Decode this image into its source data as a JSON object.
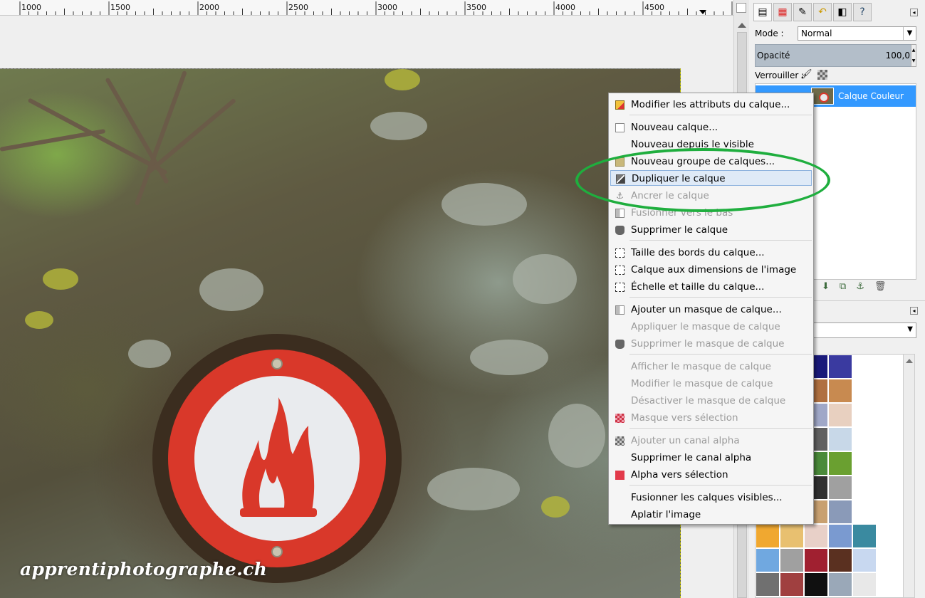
{
  "ruler": {
    "ticks": [
      "1000",
      "1500",
      "2000",
      "2500",
      "3000",
      "3500",
      "4000",
      "4500"
    ]
  },
  "canvas": {
    "watermark": "apprentiphotographe.ch"
  },
  "layers_panel": {
    "mode_label": "Mode :",
    "mode_value": "Normal",
    "opacity_label": "Opacité",
    "opacity_value": "100,0",
    "lock_label": "Verrouiller :",
    "layer_name": "Calque Couleur"
  },
  "context_menu": {
    "items": [
      {
        "label": "Modifier les attributs du calque...",
        "enabled": true,
        "icon": "pencil-icon"
      },
      {
        "label": "Nouveau calque...",
        "enabled": true,
        "icon": "new-document-icon"
      },
      {
        "label": "Nouveau depuis le visible",
        "enabled": true,
        "icon": ""
      },
      {
        "label": "Nouveau groupe de calques...",
        "enabled": true,
        "icon": "folder-icon"
      },
      {
        "label": "Dupliquer le calque",
        "enabled": true,
        "highlighted": true,
        "icon": "duplicate-icon"
      },
      {
        "label": "Ancrer le calque",
        "enabled": false,
        "icon": "anchor-icon"
      },
      {
        "label": "Fusionner vers le bas",
        "enabled": false,
        "icon": "merge-down-icon"
      },
      {
        "label": "Supprimer le calque",
        "enabled": true,
        "icon": "trash-icon"
      },
      {
        "label": "Taille des bords du calque...",
        "enabled": true,
        "icon": "layer-boundary-icon"
      },
      {
        "label": "Calque aux dimensions de l'image",
        "enabled": true,
        "icon": "layer-to-image-size-icon"
      },
      {
        "label": "Échelle et taille du calque...",
        "enabled": true,
        "icon": "scale-layer-icon"
      },
      {
        "label": "Ajouter un masque de calque...",
        "enabled": true,
        "icon": "add-mask-icon"
      },
      {
        "label": "Appliquer le masque de calque",
        "enabled": false,
        "icon": ""
      },
      {
        "label": "Supprimer le masque de calque",
        "enabled": false,
        "icon": "trash-icon"
      },
      {
        "label": "Afficher le masque de calque",
        "enabled": false,
        "icon": ""
      },
      {
        "label": "Modifier le masque de calque",
        "enabled": false,
        "icon": ""
      },
      {
        "label": "Désactiver le masque de calque",
        "enabled": false,
        "icon": ""
      },
      {
        "label": "Masque vers sélection",
        "enabled": false,
        "icon": "mask-to-selection-icon"
      },
      {
        "label": "Ajouter un canal alpha",
        "enabled": false,
        "icon": "alpha-channel-icon"
      },
      {
        "label": "Supprimer le canal alpha",
        "enabled": true,
        "icon": ""
      },
      {
        "label": "Alpha vers sélection",
        "enabled": true,
        "icon": "alpha-to-selection-icon"
      },
      {
        "label": "Fusionner les calques visibles...",
        "enabled": true,
        "icon": ""
      },
      {
        "label": "Aplatir l'image",
        "enabled": true,
        "icon": ""
      }
    ]
  },
  "colors": {
    "highlight_bg": "#dfeaf7",
    "selection_blue": "#3399ff",
    "annotation_green": "#1fae3e",
    "sign_red": "#d9382a"
  }
}
